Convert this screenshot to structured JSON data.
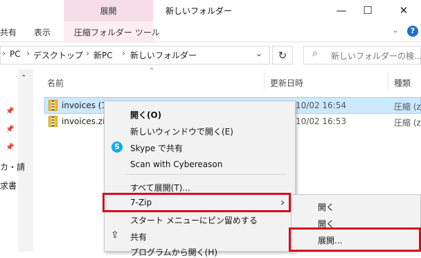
{
  "window": {
    "title": "新しいフォルダー",
    "context_tab_top": "展開",
    "context_tab_label": "圧縮フォルダー ツール",
    "minimize": "—",
    "maximize": "☐",
    "close": "✕"
  },
  "ribbon": {
    "tabs": [
      "共有",
      "表示"
    ],
    "help": "?"
  },
  "address": {
    "crumbs": [
      "PC",
      "デスクトップ",
      "新PC",
      "新しいフォルダー"
    ],
    "search_placeholder": "新しいフォルダーの検..."
  },
  "nav": {
    "items": [
      "カ・請",
      "求書"
    ]
  },
  "columns": {
    "name": "名前",
    "date": "更新日時",
    "type": "種類"
  },
  "files": [
    {
      "name": "invoices (1",
      "date": "10/02 16:54",
      "type": "圧縮 (z"
    },
    {
      "name": "invoices.zip",
      "date": "10/02 16:53",
      "type": "圧縮 (z"
    }
  ],
  "context_menu": {
    "items": [
      "開く(O)",
      "新しいウィンドウで開く(E)",
      "Skype で共有",
      "Scan with Cybereason",
      "すべて展開(T)...",
      "7-Zip",
      "スタート メニューにピン留めする",
      "共有",
      "プログラムから開く(H)"
    ]
  },
  "submenu": {
    "items": [
      "開く",
      "開く",
      "展開..."
    ]
  },
  "colors": {
    "highlight_border": "#d20f1e",
    "selected_row": "#cde8ff",
    "context_tab": "#f7dde7"
  }
}
